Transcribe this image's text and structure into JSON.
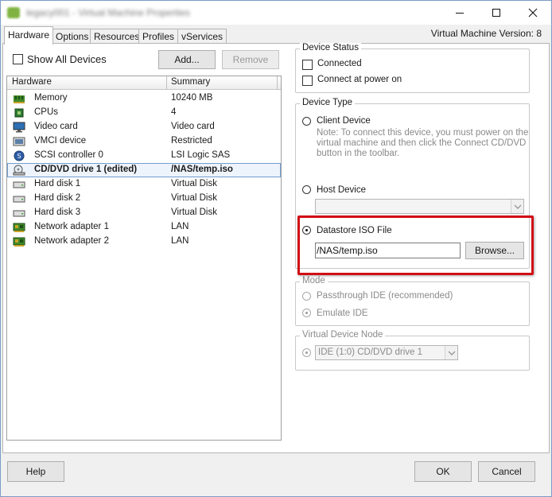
{
  "window": {
    "title": "legacy001 - Virtual Machine Properties",
    "minimize_icon": "minimize-icon",
    "maximize_icon": "maximize-icon",
    "close_icon": "close-icon"
  },
  "tabs": [
    {
      "label": "Hardware",
      "active": true
    },
    {
      "label": "Options"
    },
    {
      "label": "Resources"
    },
    {
      "label": "Profiles"
    },
    {
      "label": "vServices"
    }
  ],
  "vm_version": "Virtual Machine Version: 8",
  "left": {
    "show_all_label": "Show All Devices",
    "add_label": "Add...",
    "remove_label": "Remove",
    "columns": {
      "hardware": "Hardware",
      "summary": "Summary"
    },
    "rows": [
      {
        "name": "Memory",
        "summary": "10240 MB",
        "icon": "memory-icon"
      },
      {
        "name": "CPUs",
        "summary": "4",
        "icon": "cpu-icon"
      },
      {
        "name": "Video card",
        "summary": "Video card",
        "icon": "monitor-icon"
      },
      {
        "name": "VMCI device",
        "summary": "Restricted",
        "icon": "vmci-icon"
      },
      {
        "name": "SCSI controller 0",
        "summary": "LSI Logic SAS",
        "icon": "scsi-icon"
      },
      {
        "name": "CD/DVD drive 1 (edited)",
        "summary": "/NAS/temp.iso",
        "icon": "cd-drive-icon",
        "selected": true
      },
      {
        "name": "Hard disk 1",
        "summary": "Virtual Disk",
        "icon": "hard-disk-icon"
      },
      {
        "name": "Hard disk 2",
        "summary": "Virtual Disk",
        "icon": "hard-disk-icon"
      },
      {
        "name": "Hard disk 3",
        "summary": "Virtual Disk",
        "icon": "hard-disk-icon"
      },
      {
        "name": "Network adapter 1",
        "summary": "LAN",
        "icon": "network-adapter-icon"
      },
      {
        "name": "Network adapter 2",
        "summary": "LAN",
        "icon": "network-adapter-icon"
      }
    ]
  },
  "device_status": {
    "title": "Device Status",
    "connected": "Connected",
    "connect_at_power_on": "Connect at power on"
  },
  "device_type": {
    "title": "Device Type",
    "client_device": "Client Device",
    "note_line1": "Note: To connect this device, you must power on the",
    "note_line2": "virtual machine and then click the Connect CD/DVD",
    "note_line3": "button in the toolbar.",
    "host_device": "Host Device",
    "host_device_value": "",
    "datastore_iso": "Datastore ISO File",
    "iso_path": "/NAS/temp.iso",
    "browse_label": "Browse...",
    "selected": "datastore_iso"
  },
  "mode": {
    "title": "Mode",
    "passthrough": "Passthrough IDE (recommended)",
    "emulate": "Emulate IDE",
    "selected": "emulate"
  },
  "vdn": {
    "title": "Virtual Device Node",
    "value": "IDE (1:0) CD/DVD drive 1"
  },
  "footer": {
    "help_label": "Help",
    "ok_label": "OK",
    "cancel_label": "Cancel"
  },
  "colors": {
    "highlight": "#d10d14",
    "selection_border": "#6f9ed0"
  }
}
